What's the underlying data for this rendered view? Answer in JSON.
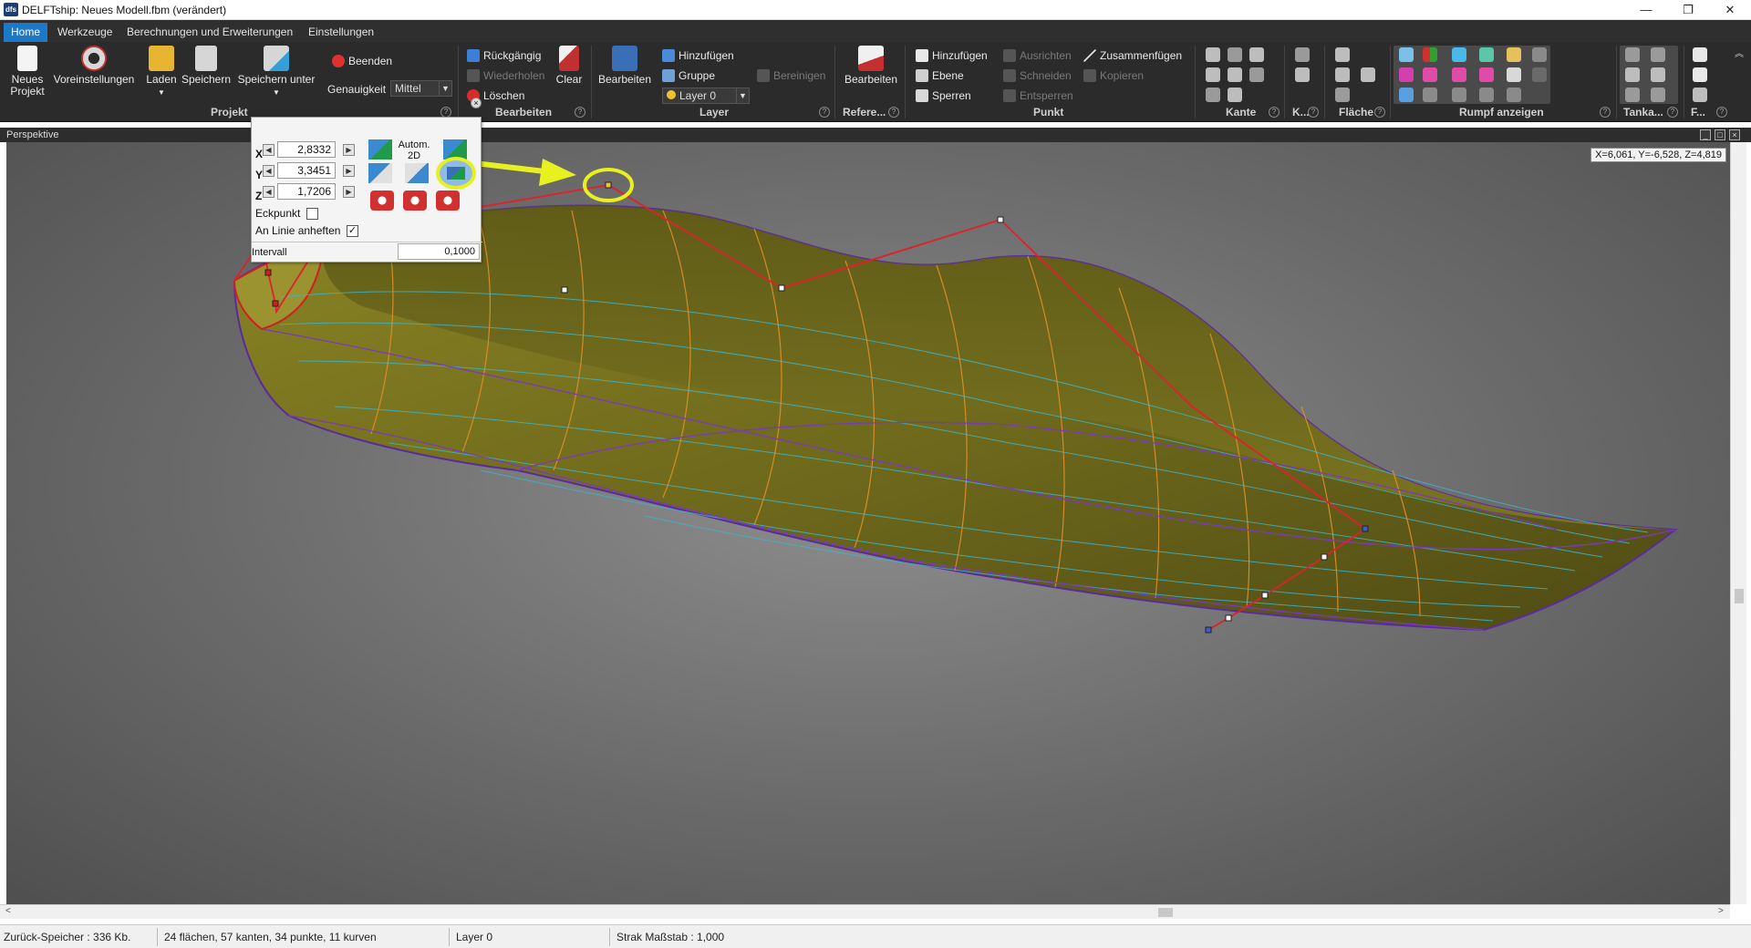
{
  "titlebar": {
    "icon_text": "dfs",
    "title": "DELFTship: Neues Modell.fbm (verändert)",
    "minimize": "—",
    "restore": "❐",
    "close": "✕"
  },
  "tabs": [
    "Home",
    "Werkzeuge",
    "Berechnungen und Erweiterungen",
    "Einstellungen"
  ],
  "ribbon": {
    "projekt": {
      "group": "Projekt",
      "neues_line1": "Neues",
      "neues_line2": "Projekt",
      "voreinstellungen": "Voreinstellungen",
      "laden": "Laden",
      "speichern": "Speichern",
      "speichern_unter": "Speichern unter",
      "beenden": "Beenden",
      "genauigkeit_label": "Genauigkeit",
      "genauigkeit_value": "Mittel"
    },
    "bearbeiten": {
      "group": "Bearbeiten",
      "rueckgaengig": "Rückgängig",
      "wiederholen": "Wiederholen",
      "loeschen": "Löschen",
      "clear": "Clear"
    },
    "layer": {
      "group": "Layer",
      "bearbeiten": "Bearbeiten",
      "hinzufuegen": "Hinzufügen",
      "gruppe": "Gruppe",
      "layer_value": "Layer 0",
      "bereinigen": "Bereinigen"
    },
    "referenz": {
      "group": "Refere...",
      "bearbeiten": "Bearbeiten"
    },
    "punkt": {
      "group": "Punkt",
      "hinzufuegen": "Hinzufügen",
      "ebene": "Ebene",
      "sperren": "Sperren",
      "ausrichten": "Ausrichten",
      "schneiden": "Schneiden",
      "entsperren": "Entsperren",
      "zusammenfuegen": "Zusammenfügen",
      "kopieren": "Kopieren"
    },
    "kante": {
      "group": "Kante"
    },
    "k": {
      "group": "K..."
    },
    "flaeche": {
      "group": "Fläche"
    },
    "rumpf": {
      "group": "Rumpf anzeigen"
    },
    "tanka": {
      "group": "Tanka..."
    },
    "f": {
      "group": "F..."
    }
  },
  "viewport": {
    "title": "Perspektive",
    "coordinates": "X=6,061, Y=-6,528, Z=4,819"
  },
  "panel": {
    "x_label": "X",
    "y_label": "Y",
    "z_label": "Z",
    "x_value": "2,8332",
    "y_value": "3,3451",
    "z_value": "1,7206",
    "autom_line1": "Autom.",
    "autom_line2": "2D",
    "eckpunkt": "Eckpunkt",
    "an_linie": "An Linie anheften",
    "an_linie_checked": "✓",
    "intervall_label": "Intervall",
    "intervall_value": "0,1000",
    "close": "×"
  },
  "status": {
    "speicher": "Zurück-Speicher : 336 Kb.",
    "counts": "24 flächen, 57 kanten, 34 punkte, 11 kurven",
    "layer": "Layer 0",
    "strak": "Strak Maßstab : 1,000"
  },
  "colors": {
    "ribbon_bg": "#2b2b2b",
    "tab_active": "#1e78c8",
    "hull_fill": "#7a7520",
    "control_net": "#e0202a",
    "highlight": "#e8f020"
  }
}
